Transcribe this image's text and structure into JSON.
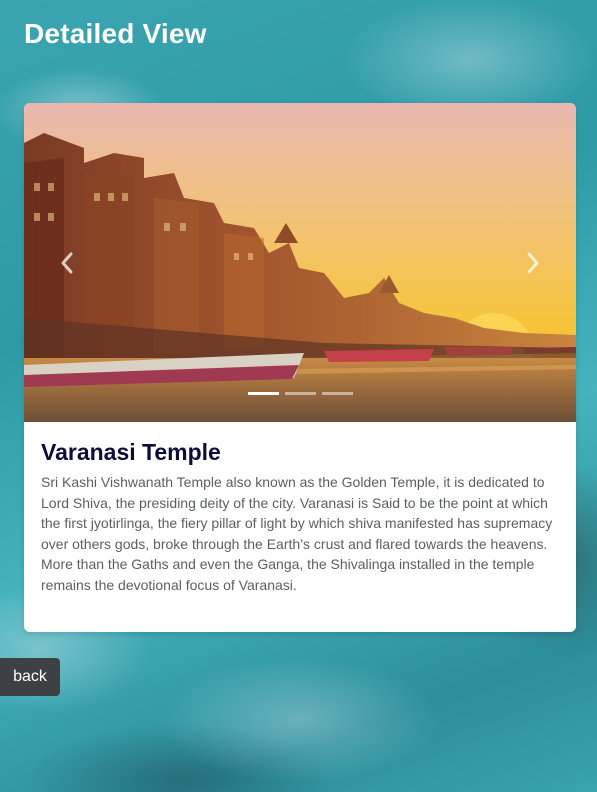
{
  "page": {
    "title": "Detailed View"
  },
  "carousel": {
    "slide_count": 3,
    "active_index": 0,
    "image_subject": "varanasi-ghats-sunset",
    "prev_icon": "chevron-left-icon",
    "next_icon": "chevron-right-icon"
  },
  "card": {
    "title": "Varanasi Temple",
    "description": "Sri Kashi Vishwanath Temple also known as the Golden Temple, it is dedicated to Lord Shiva, the presiding deity of the city. Varanasi is Said to be the point at which the first jyotirlinga, the fiery pillar of light by which shiva manifested has supremacy over others gods, broke through the Earth’s crust and flared towards the heavens. More than the Gaths and even the Ganga, the Shivalinga installed in the temple remains the devotional focus of Varanasi."
  },
  "back_button": {
    "label": "back"
  },
  "colors": {
    "title_text": "#ffffff",
    "card_title": "#0c0c3e",
    "card_text": "#5b5f63",
    "back_button_bg": "#3d4145"
  }
}
